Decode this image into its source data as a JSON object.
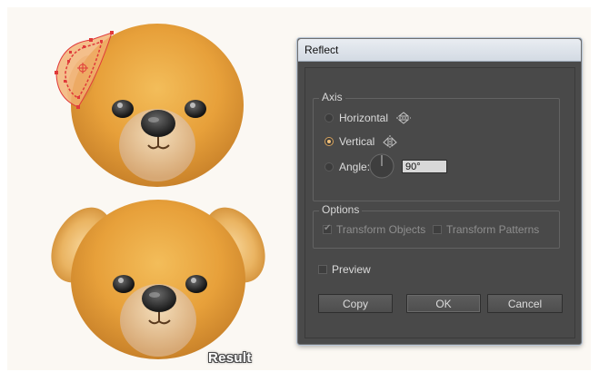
{
  "canvas": {
    "result_label": "Result"
  },
  "dialog": {
    "title": "Reflect",
    "axis": {
      "legend": "Axis",
      "horizontal_label": "Horizontal",
      "horizontal_icon": "reflect-horizontal-icon",
      "vertical_label": "Vertical",
      "vertical_icon": "reflect-vertical-icon",
      "angle_label": "Angle:",
      "angle_value": "90°",
      "selected": "Vertical"
    },
    "options": {
      "legend": "Options",
      "transform_objects_label": "Transform Objects",
      "transform_objects_checked": true,
      "transform_patterns_label": "Transform Patterns",
      "transform_patterns_checked": false
    },
    "preview_label": "Preview",
    "preview_checked": false,
    "buttons": {
      "copy": "Copy",
      "ok": "OK",
      "cancel": "Cancel"
    }
  },
  "colors": {
    "bear_fur": "#e8a43c",
    "dialog_bg": "#494949",
    "titlebar": "#dde3ea",
    "selection": "#e03a3a"
  }
}
